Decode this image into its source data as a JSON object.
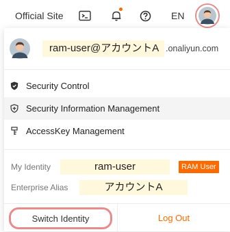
{
  "topbar": {
    "official_site": "Official Site",
    "language": "EN",
    "icons": [
      "terminal-icon",
      "bell-icon",
      "help-icon",
      "avatar-icon"
    ],
    "bell_dot_color": "#ff6a00"
  },
  "account": {
    "name": "ram-user@アカウントA",
    "domain": ".onaliyun.com"
  },
  "menu": {
    "items": [
      {
        "label": "Security Control",
        "icon": "shield-icon"
      },
      {
        "label": "Security Information Management",
        "icon": "shield-info-icon"
      },
      {
        "label": "AccessKey Management",
        "icon": "key-icon"
      }
    ]
  },
  "identity": {
    "my_identity_label": "My Identity",
    "my_identity_value": "ram-user",
    "badge": "RAM User",
    "alias_label": "Enterprise Alias",
    "alias_value": "アカウントA"
  },
  "footer": {
    "switch_identity": "Switch Identity",
    "log_out": "Log Out"
  },
  "colors": {
    "accent": "#ff6a00",
    "highlight": "#fff8dc",
    "annotation": "#e88b8b"
  }
}
